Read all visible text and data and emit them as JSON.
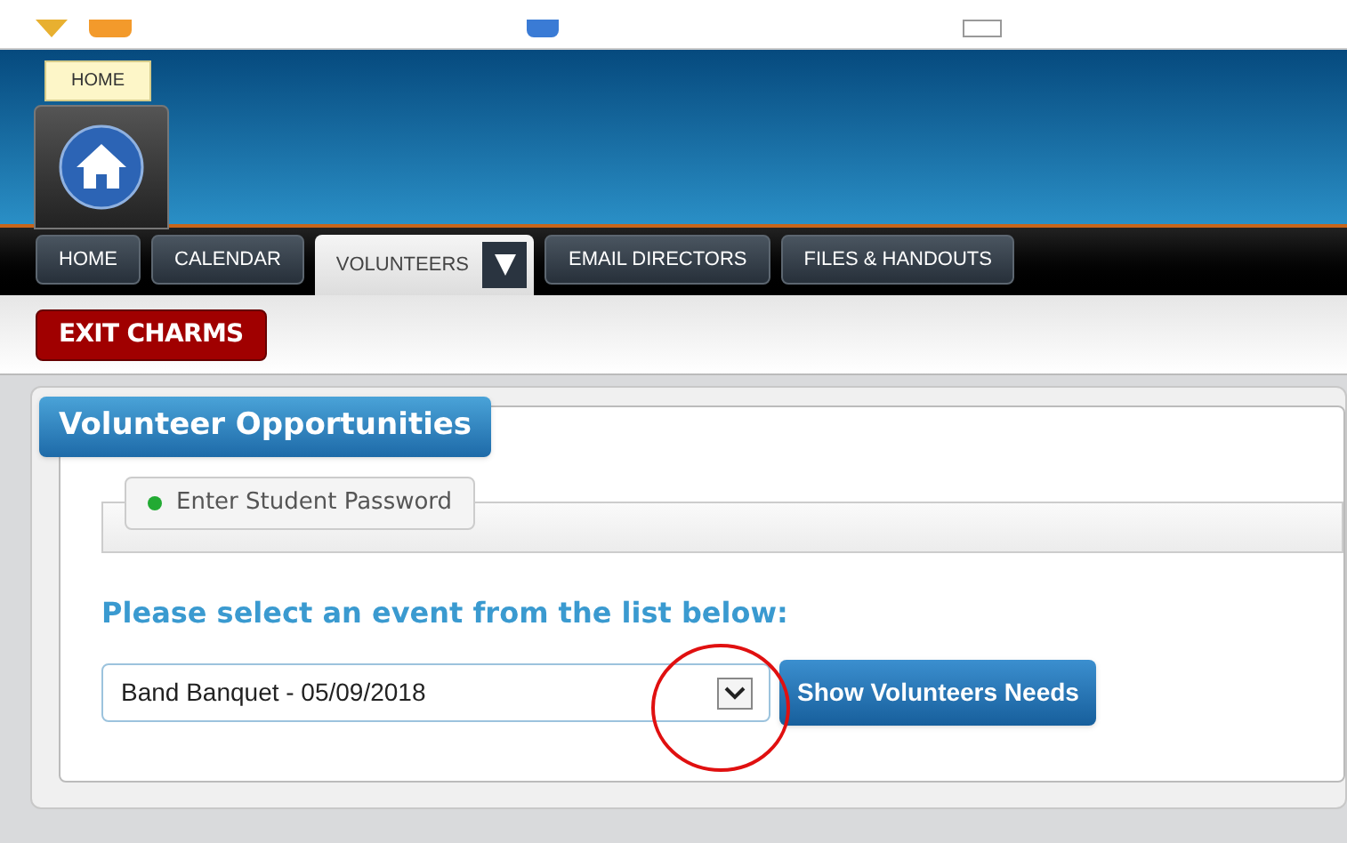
{
  "header": {
    "home_tooltip": "HOME"
  },
  "nav_tabs": [
    {
      "label": "HOME",
      "selected": false
    },
    {
      "label": "CALENDAR",
      "selected": false
    },
    {
      "label": "VOLUNTEERS",
      "selected": true,
      "has_dropdown": true
    },
    {
      "label": "EMAIL DIRECTORS",
      "selected": false
    },
    {
      "label": "FILES & HANDOUTS",
      "selected": false
    }
  ],
  "exit_button": "EXIT CHARMS",
  "panel": {
    "title": "Volunteer Opportunities",
    "password_tab": {
      "label": "Enter Student Password",
      "color": "#22aa33"
    },
    "prompt": "Please select an event from the list below:",
    "event_select": {
      "value": "Band Banquet - 05/09/2018"
    },
    "show_button": "Show Volunteers Needs"
  }
}
